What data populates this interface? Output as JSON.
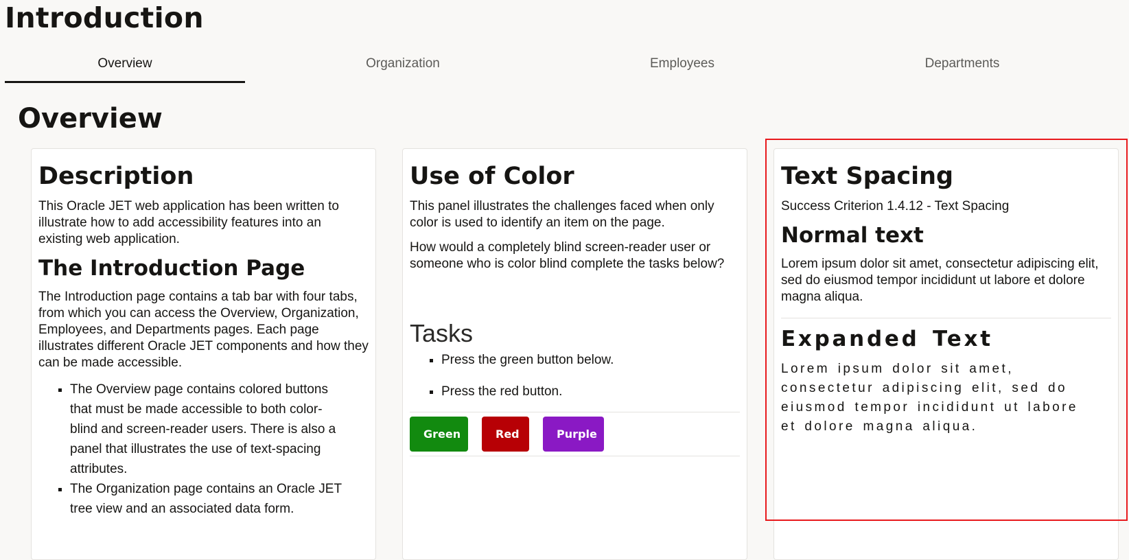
{
  "page_title": "Introduction",
  "tabs": [
    {
      "label": "Overview",
      "selected": true
    },
    {
      "label": "Organization",
      "selected": false
    },
    {
      "label": "Employees",
      "selected": false
    },
    {
      "label": "Departments",
      "selected": false
    }
  ],
  "section_title": "Overview",
  "description_panel": {
    "title": "Description",
    "intro": "This Oracle JET web application has been written to illustrate how to add accessibility features into an existing web application.",
    "subtitle": "The Introduction Page",
    "body": "The Introduction page contains a tab bar with four tabs, from which you can access the Overview, Organization, Employees, and Departments pages. Each page illustrates different Oracle JET components and how they can be made accessible.",
    "bullets": [
      "The Overview page contains colored buttons that must be made accessible to both color-blind and screen-reader users. There is also a panel that illustrates the use of text-spacing attributes.",
      "The Organization page contains an Oracle JET tree view and an associated data form."
    ]
  },
  "color_panel": {
    "title": "Use of Color",
    "p1": "This panel illustrates the challenges faced when only color is used to identify an item on the page.",
    "p2": "How would a completely blind screen-reader user or someone who is color blind complete the tasks below?",
    "tasks_heading": "Tasks",
    "tasks": [
      "Press the green button below.",
      "Press the red button."
    ],
    "buttons": [
      {
        "label": "Green",
        "color": "#128a0f"
      },
      {
        "label": "Red",
        "color": "#b70005"
      },
      {
        "label": "Purple",
        "color": "#8a19c4"
      }
    ]
  },
  "spacing_panel": {
    "title": "Text Spacing",
    "criterion": "Success Criterion 1.4.12 - Text Spacing",
    "normal_heading": "Normal text",
    "normal_text": "Lorem ipsum dolor sit amet, consectetur adipiscing elit, sed do eiusmod tempor incididunt ut labore et dolore magna aliqua.",
    "expanded_heading": "Expanded Text",
    "expanded_text": "Lorem ipsum dolor sit amet, consectetur adipiscing elit, sed do eiusmod tempor incididunt ut labore et dolore magna aliqua."
  },
  "colors": {
    "highlight": "#e8191c",
    "tab_underline": "#161513"
  }
}
